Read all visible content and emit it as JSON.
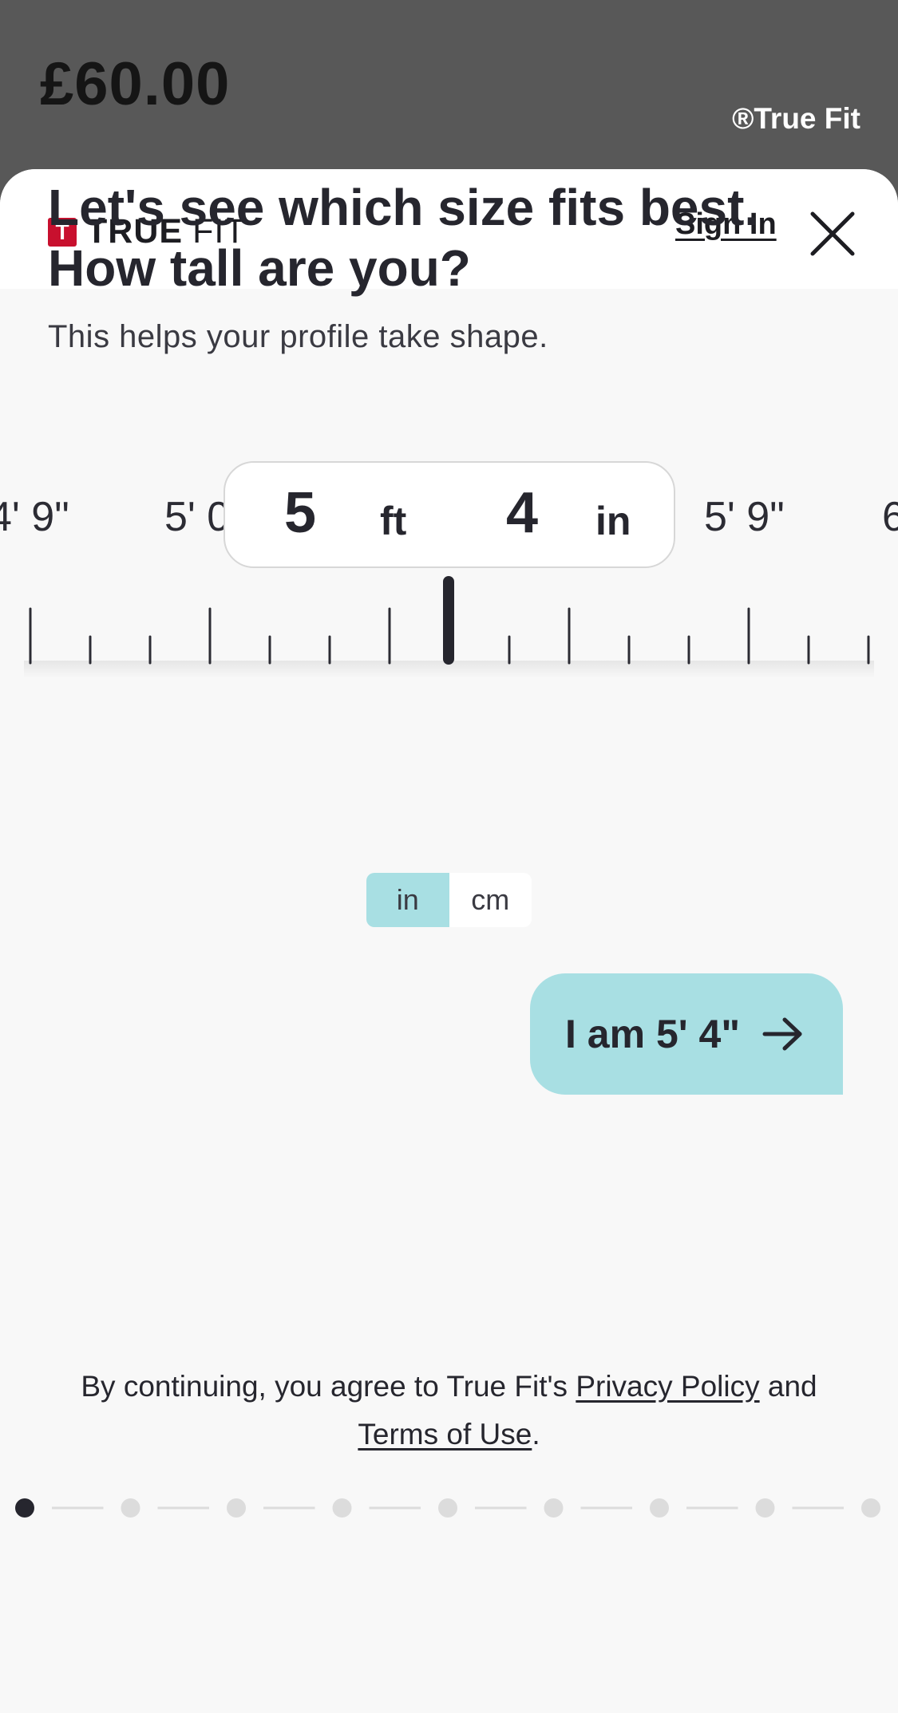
{
  "background": {
    "price": "£60.00",
    "brand": "®True Fit"
  },
  "header": {
    "logo_bold": "TRUE",
    "logo_light": "FIT",
    "logo_mark": "T",
    "sign_in": "Sign In",
    "close_icon": "close-icon"
  },
  "main": {
    "heading_line1": "Let's see which size fits best.",
    "heading_line2": "How tall are you?",
    "subheading": "This helps your profile take shape."
  },
  "ruler": {
    "labels": [
      "4' 9\"",
      "5' 0",
      "5' 9\"",
      "6"
    ],
    "feet_value": "5",
    "feet_unit": "ft",
    "inches_value": "4",
    "inches_unit": "in"
  },
  "units": {
    "options": [
      "in",
      "cm"
    ],
    "selected": "in"
  },
  "cta": {
    "label": "I am 5' 4\"",
    "icon": "arrow-right-icon"
  },
  "legal": {
    "prefix": "By continuing, you agree to True Fit's ",
    "privacy_link": "Privacy Policy",
    "middle": " and",
    "terms_link": "Terms of Use",
    "suffix": "."
  },
  "progress": {
    "total_steps": 9,
    "current_step": 1
  },
  "colors": {
    "accent": "#a8dfe3",
    "brand_red": "#c8102e",
    "text_dark": "#26262e"
  }
}
